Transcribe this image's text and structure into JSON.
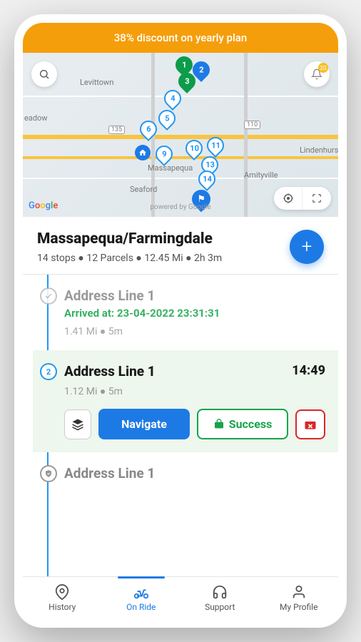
{
  "promo": {
    "text": "38% discount on yearly plan"
  },
  "map": {
    "labels": {
      "levittown": "Levittown",
      "eadow": "eadow",
      "massapequa": "Massapequa",
      "seaford": "Seaford",
      "amityville": "Amityville",
      "lindenhurst": "Lindenhurs",
      "shield135": "135",
      "shield110": "110"
    },
    "bell_badge": "20",
    "pins": {
      "p1": "1",
      "p2": "2",
      "p3": "3",
      "p4": "4",
      "p5": "5",
      "p6": "6",
      "p9": "9",
      "p10": "10",
      "p11": "11",
      "p13": "13",
      "p14": "14"
    },
    "google": "Google",
    "powered": "powered by Google"
  },
  "route": {
    "title": "Massapequa/Farmingdale",
    "meta": "14 stops ● 12 Parcels ● 12.45 Mi ● 2h 3m"
  },
  "stops": [
    {
      "marker": "✓",
      "title": "Address Line 1",
      "arrived": "Arrived at: 23-04-2022 23:31:31",
      "distance": "1.41 Mi ● 5m"
    },
    {
      "marker": "2",
      "title": "Address Line 1",
      "time": "14:49",
      "distance": "1.12 Mi ● 5m",
      "navigate": "Navigate",
      "success": "Success"
    },
    {
      "title": "Address Line 1"
    }
  ],
  "nav": {
    "history": "History",
    "onride": "On Ride",
    "support": "Support",
    "profile": "My Profile"
  }
}
